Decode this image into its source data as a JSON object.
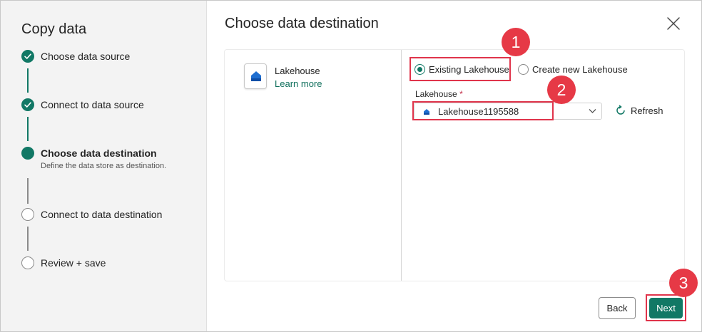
{
  "wizard": {
    "title": "Copy data",
    "steps": [
      {
        "label": "Choose data source",
        "status": "completed"
      },
      {
        "label": "Connect to data source",
        "status": "completed"
      },
      {
        "label": "Choose data destination",
        "status": "current",
        "description": "Define the data store as destination."
      },
      {
        "label": "Connect to data destination",
        "status": "pending"
      },
      {
        "label": "Review + save",
        "status": "pending"
      }
    ]
  },
  "page": {
    "title": "Choose data destination",
    "close_icon": "close-icon"
  },
  "destination": {
    "name": "Lakehouse",
    "link": "Learn more",
    "icon": "lakehouse-icon"
  },
  "options": {
    "existing_label": "Existing Lakehouse",
    "existing_selected": true,
    "new_label": "Create new Lakehouse",
    "new_selected": false
  },
  "lakehouse_field": {
    "label": "Lakehouse",
    "required_marker": "*",
    "value": "Lakehouse1195588"
  },
  "refresh": {
    "label": "Refresh"
  },
  "footer": {
    "back_label": "Back",
    "next_label": "Next"
  },
  "annotations": {
    "badge1": "1",
    "badge2": "2",
    "badge3": "3"
  },
  "colors": {
    "accent": "#117865",
    "highlight": "#e0344b",
    "badge": "#e63946"
  }
}
